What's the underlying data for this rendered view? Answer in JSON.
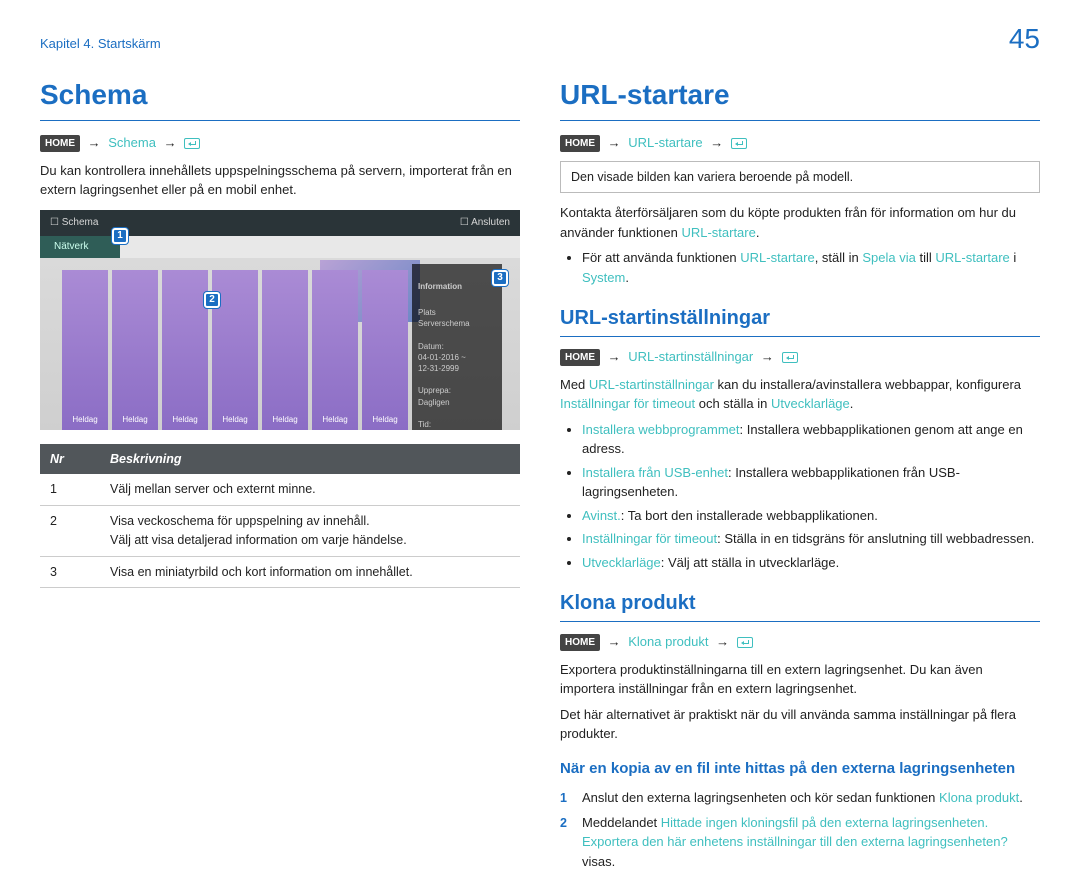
{
  "header": {
    "chapter": "Kapitel 4. Startskärm",
    "page": "45"
  },
  "badge": {
    "home": "HOME"
  },
  "left": {
    "title": "Schema",
    "path_link": "Schema",
    "intro": "Du kan kontrollera innehållets uppspelningsschema på servern, importerat från en extern lagringsenhet eller på en mobil enhet.",
    "screenshot": {
      "title": "Schema",
      "connected": "Ansluten",
      "tab": "Nätverk",
      "days": [
        "Heldag",
        "Heldag",
        "Heldag",
        "Heldag",
        "Heldag",
        "Heldag",
        "Heldag"
      ],
      "info_title": "Information",
      "info_lines": "Plats\nServerschema\n\nDatum:\n04-01-2016 ~\n12-31-2999\n\nUpprepa:\nDagligen\n\nTid:\nHela dagen"
    },
    "table": {
      "headers": {
        "nr": "Nr",
        "desc": "Beskrivning"
      },
      "rows": [
        {
          "nr": "1",
          "desc": "Välj mellan server och externt minne."
        },
        {
          "nr": "2",
          "desc": "Visa veckoschema för uppspelning av innehåll.\nVälj att visa detaljerad information om varje händelse."
        },
        {
          "nr": "3",
          "desc": "Visa en miniatyrbild och kort information om innehållet."
        }
      ]
    }
  },
  "right": {
    "sec1": {
      "title": "URL-startare",
      "path_link": "URL-startare",
      "note": "Den visade bilden kan variera beroende på modell.",
      "p1a": "Kontakta återförsäljaren som du köpte produkten från för information om hur du använder funktionen ",
      "p1b": "URL-startare",
      "p1c": ".",
      "b_pre": "För att använda funktionen ",
      "b_url": "URL-startare",
      "b_mid1": ", ställ in ",
      "b_spela": "Spela via",
      "b_mid2": " till ",
      "b_url2": "URL-startare",
      "b_mid3": " i ",
      "b_sys": "System",
      "b_end": "."
    },
    "sec2": {
      "title": "URL-startinställningar",
      "path_link": "URL-startinställningar",
      "p_pre": "Med ",
      "p_link": "URL-startinställningar",
      "p_mid": " kan du installera/avinstallera webbappar, konfigurera ",
      "p_inst": "Inställningar för timeout",
      "p_mid2": " och ställa in ",
      "p_dev": "Utvecklarläge",
      "p_end": ".",
      "bullets": [
        {
          "k": "Installera webbprogrammet",
          "v": ": Installera webbapplikationen genom att ange en adress."
        },
        {
          "k": "Installera från USB-enhet",
          "v": ": Installera webbapplikationen från USB-lagringsenheten."
        },
        {
          "k": "Avinst.",
          "v": ": Ta bort den installerade webbapplikationen."
        },
        {
          "k": "Inställningar för timeout",
          "v": ": Ställa in en tidsgräns för anslutning till webbadressen."
        },
        {
          "k": "Utvecklarläge",
          "v": ": Välj att ställa in utvecklarläge."
        }
      ]
    },
    "sec3": {
      "title": "Klona produkt",
      "path_link": "Klona produkt",
      "p1": "Exportera produktinställningarna till en extern lagringsenhet. Du kan även importera inställningar från en extern lagringsenhet.",
      "p2": "Det här alternativet är praktiskt när du vill använda samma inställningar på flera produkter.",
      "sub_title": "När en kopia av en fil inte hittas på den externa lagringsenheten",
      "steps": {
        "s1a": "Anslut den externa lagringsenheten och kör sedan funktionen ",
        "s1b": "Klona produkt",
        "s1c": ".",
        "s2a": "Meddelandet ",
        "s2b": "Hittade ingen kloningsfil på den externa lagringsenheten. Exportera den här enhetens inställningar till den externa lagringsenheten?",
        "s2c": " visas."
      }
    }
  }
}
